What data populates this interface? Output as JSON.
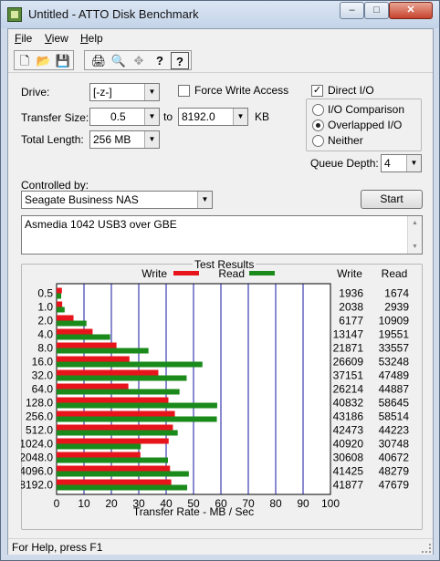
{
  "window": {
    "title": "Untitled - ATTO Disk Benchmark",
    "min_glyph": "–",
    "max_glyph": "□",
    "close_glyph": "✕"
  },
  "menu": [
    {
      "first": "F",
      "rest": "ile"
    },
    {
      "first": "V",
      "rest": "iew"
    },
    {
      "first": "H",
      "rest": "elp"
    }
  ],
  "toolbar": {
    "new": "🗋",
    "open": "📂",
    "save": "💾",
    "print": "🖨",
    "print_preview": "🔍",
    "move": "✥",
    "about": "?",
    "context_help": "?"
  },
  "settings": {
    "drive_label": "Drive:",
    "drive_value": "[-z-]",
    "force_write_label": "Force Write Access",
    "force_write_checked": false,
    "direct_io_label": "Direct I/O",
    "direct_io_checked": true,
    "direct_io_mark": "✓",
    "transfer_size_label": "Transfer Size:",
    "transfer_from": "0.5",
    "to_label": "to",
    "transfer_to": "8192.0",
    "kb_label": "KB",
    "total_length_label": "Total Length:",
    "total_length_value": "256 MB",
    "io_options": [
      "I/O Comparison",
      "Overlapped I/O",
      "Neither"
    ],
    "io_selected": "Overlapped I/O",
    "queue_depth_label": "Queue Depth:",
    "queue_depth_value": "4",
    "controlled_by_label": "Controlled by:",
    "controlled_by_value": "Seagate Business NAS",
    "start_label": "Start",
    "description": "Asmedia 1042 USB3 over GBE"
  },
  "results": {
    "title": "Test Results",
    "legend_write": "Write",
    "legend_read": "Read",
    "col_write": "Write",
    "col_read": "Read",
    "x_axis_label": "Transfer Rate - MB / Sec",
    "colors": {
      "write": "#e8141c",
      "read": "#1a8a1a",
      "grid": "#1414a0"
    }
  },
  "chart_data": {
    "type": "bar",
    "orientation": "horizontal",
    "title": "Test Results",
    "xlabel": "Transfer Rate - MB / Sec",
    "xlim": [
      0,
      100
    ],
    "xticks": [
      0,
      10,
      20,
      30,
      40,
      50,
      60,
      70,
      80,
      90,
      100
    ],
    "categories": [
      "0.5",
      "1.0",
      "2.0",
      "4.0",
      "8.0",
      "16.0",
      "32.0",
      "64.0",
      "128.0",
      "256.0",
      "512.0",
      "1024.0",
      "2048.0",
      "4096.0",
      "8192.0"
    ],
    "series": [
      {
        "name": "Write",
        "values": [
          1936,
          2038,
          6177,
          13147,
          21871,
          26609,
          37151,
          26214,
          40832,
          43186,
          42473,
          40920,
          30608,
          41425,
          41877
        ]
      },
      {
        "name": "Read",
        "values": [
          1674,
          2939,
          10909,
          19551,
          33557,
          53248,
          47489,
          44887,
          58645,
          58514,
          44223,
          30748,
          40672,
          48279,
          47679
        ]
      }
    ],
    "units": "KB/s (bars plotted in MB/s)"
  },
  "status": {
    "text": "For Help, press F1"
  }
}
